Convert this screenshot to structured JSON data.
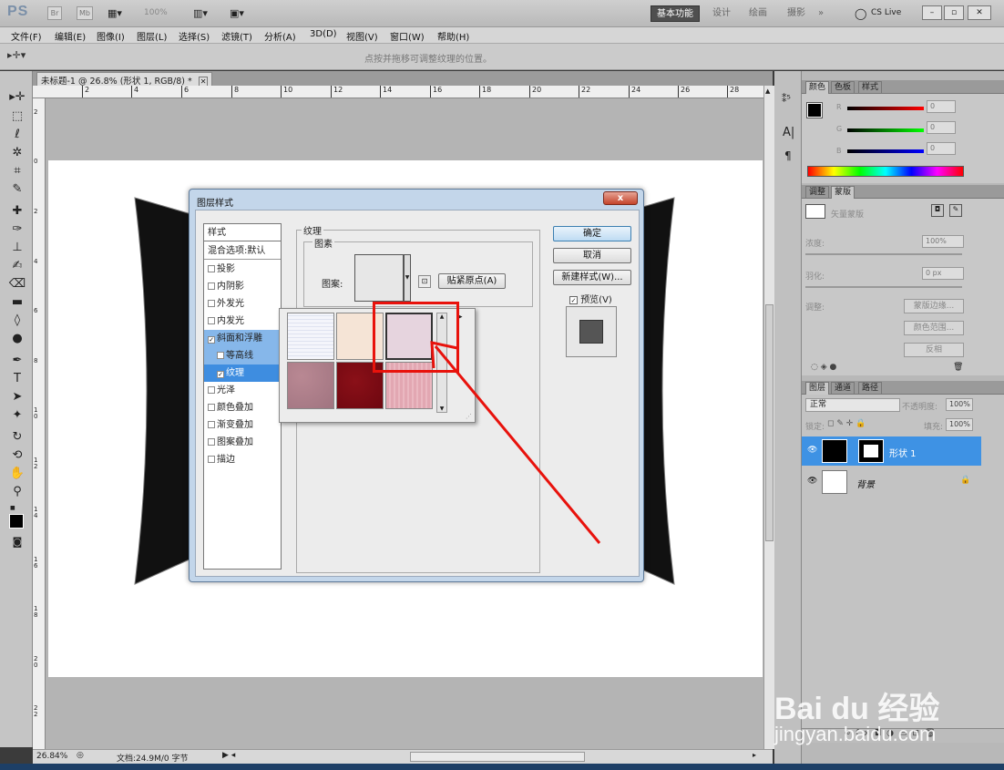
{
  "app": {
    "logo": "PS",
    "toolbar_icons": [
      "Br",
      "Mb"
    ],
    "zoom_label": "100%",
    "workspaces": [
      "基本功能",
      "设计",
      "绘画",
      "摄影",
      "»"
    ],
    "cslive": "CS Live",
    "window_buttons": [
      "–",
      "▫",
      "✕"
    ]
  },
  "menu": [
    "文件(F)",
    "编辑(E)",
    "图像(I)",
    "图层(L)",
    "选择(S)",
    "滤镜(T)",
    "分析(A)",
    "3D(D)",
    "视图(V)",
    "窗口(W)",
    "帮助(H)"
  ],
  "options": {
    "hint": "点按并拖移可调整纹理的位置。"
  },
  "document": {
    "tab_title": "未标题-1 @ 26.8% (形状 1, RGB/8) *",
    "hruler_numbers": [
      "2",
      "4",
      "6",
      "8",
      "10",
      "12",
      "14",
      "16",
      "18",
      "20",
      "22",
      "24",
      "26",
      "28"
    ],
    "vruler_numbers": [
      "2",
      "0",
      "2",
      "4",
      "6",
      "8",
      "10",
      "12",
      "14",
      "16",
      "18",
      "20",
      "22"
    ]
  },
  "status": {
    "zoom": "26.84%",
    "doc_info": "文档:24.9M/0 字节"
  },
  "panels": {
    "color_tabs": [
      "颜色",
      "色板",
      "样式"
    ],
    "rgb_labels": [
      "R",
      "G",
      "B"
    ],
    "rgb_values": [
      "0",
      "0",
      "0"
    ],
    "adjust_tabs": [
      "调整",
      "蒙版"
    ],
    "mask_label": "矢量蒙版",
    "density_label": "浓度:",
    "density_value": "100%",
    "feather_label": "羽化:",
    "feather_value": "0 px",
    "refine_label": "调整:",
    "mask_buttons": [
      "蒙版边缘...",
      "颜色范围...",
      "反相"
    ],
    "layers_tabs": [
      "图层",
      "通道",
      "路径"
    ],
    "blend_mode": "正常",
    "opacity_label": "不透明度:",
    "opacity_value": "100%",
    "lock_label": "锁定:",
    "fill_label": "填充:",
    "fill_value": "100%",
    "layers": [
      {
        "name": "形状 1",
        "selected": true
      },
      {
        "name": "背景",
        "selected": false
      }
    ]
  },
  "dialog": {
    "title": "图层样式",
    "close": "x",
    "styles_header": "样式",
    "blend_header": "混合选项:默认",
    "style_items": [
      {
        "label": "投影",
        "checked": false,
        "state": ""
      },
      {
        "label": "内阴影",
        "checked": false,
        "state": ""
      },
      {
        "label": "外发光",
        "checked": false,
        "state": ""
      },
      {
        "label": "内发光",
        "checked": false,
        "state": ""
      },
      {
        "label": "斜面和浮雕",
        "checked": true,
        "state": "sub"
      },
      {
        "label": "等高线",
        "checked": false,
        "state": "sub"
      },
      {
        "label": "纹理",
        "checked": true,
        "state": "sel"
      },
      {
        "label": "光泽",
        "checked": false,
        "state": ""
      },
      {
        "label": "颜色叠加",
        "checked": false,
        "state": ""
      },
      {
        "label": "渐变叠加",
        "checked": false,
        "state": ""
      },
      {
        "label": "图案叠加",
        "checked": false,
        "state": ""
      },
      {
        "label": "描边",
        "checked": false,
        "state": ""
      }
    ],
    "section_title": "纹理",
    "group_title": "图素",
    "pattern_label": "图案:",
    "snap_button": "贴紧原点(A)",
    "ok": "确定",
    "cancel": "取消",
    "new_style": "新建样式(W)...",
    "preview": "预览(V)",
    "swatch_colors": [
      "#f4f5fb",
      "#f5e4d6",
      "#e6d4de",
      "#b98893",
      "#6e0710",
      "#e2a7b2"
    ]
  },
  "watermark": {
    "brand": "Bai du 经验",
    "url": "jingyan.baidu.com"
  }
}
